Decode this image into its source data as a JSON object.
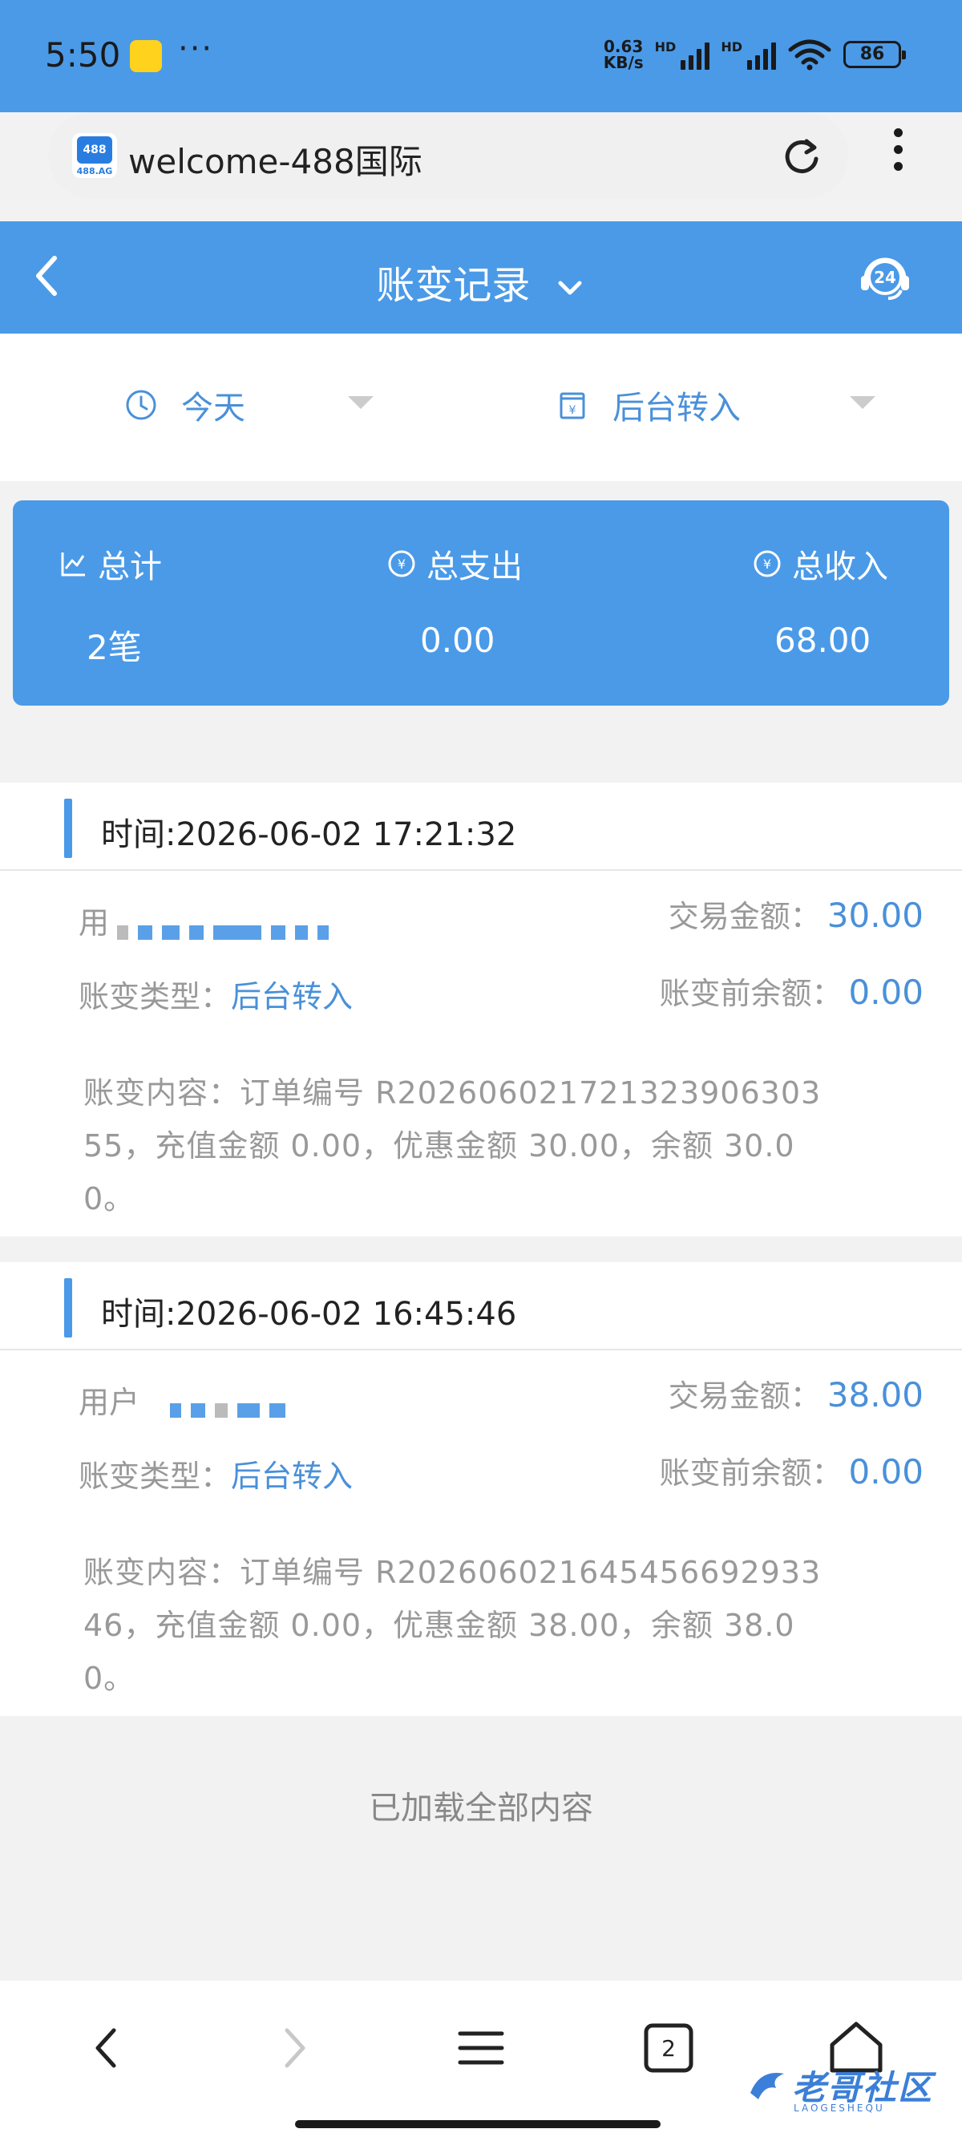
{
  "status_bar": {
    "time": "5:50",
    "dots": "···",
    "net_speed_top": "0.63",
    "net_speed_bottom": "KB/s",
    "hd": "HD",
    "battery": "86"
  },
  "browser": {
    "site_icon_label": "488",
    "site_icon_sub": "488.AG",
    "url": "welcome-488国际"
  },
  "header": {
    "title": "账变记录",
    "support_badge": "24"
  },
  "filters": {
    "date": "今天",
    "type": "后台转入"
  },
  "summary": {
    "total_label": "总计",
    "total_value": "2笔",
    "expense_label": "总支出",
    "expense_value": "0.00",
    "income_label": "总收入",
    "income_value": "68.00"
  },
  "records": [
    {
      "time": "时间:2026-06-02 17:21:32",
      "user_label": "用",
      "amount_label": "交易金额：",
      "amount": "30.00",
      "type_label": "账变类型：",
      "type": "后台转入",
      "balance_label": "账变前余额：",
      "balance": "0.00",
      "content_line1": "账变内容：订单编号 R202606021721323906303",
      "content_line2": "55，充值金额 0.00，优惠金额 30.00，余额 30.0",
      "content_line3": "0。"
    },
    {
      "time": "时间:2026-06-02 16:45:46",
      "user_label": "用户",
      "amount_label": "交易金额：",
      "amount": "38.00",
      "type_label": "账变类型：",
      "type": "后台转入",
      "balance_label": "账变前余额：",
      "balance": "0.00",
      "content_line1": "账变内容：订单编号 R202606021645456692933",
      "content_line2": "46，充值金额 0.00，优惠金额 38.00，余额 38.0",
      "content_line3": "0。"
    }
  ],
  "footer_text": "已加载全部内容",
  "bottom_nav": {
    "tab_count": "2"
  },
  "watermark": {
    "text": "老哥社区",
    "sub": "LAOGESHEQU"
  },
  "colors": {
    "brand_blue": "#4a9ae8",
    "link_blue": "#4a90d9",
    "muted_text": "#999999"
  }
}
